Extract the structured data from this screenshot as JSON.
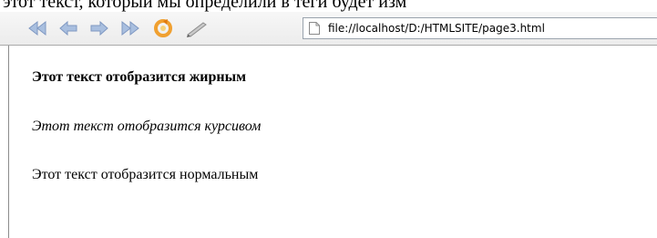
{
  "caption": "этот текст, который мы определили в теги будет изм",
  "toolbar": {
    "buttons": [
      {
        "name": "rewind-button",
        "icon": "rewind-icon"
      },
      {
        "name": "back-button",
        "icon": "back-arrow-icon"
      },
      {
        "name": "forward-button",
        "icon": "forward-arrow-icon"
      },
      {
        "name": "fast-forward-button",
        "icon": "fast-forward-icon"
      },
      {
        "name": "reload-button",
        "icon": "reload-icon"
      },
      {
        "name": "edit-button",
        "icon": "pencil-icon"
      }
    ],
    "address": {
      "url": "file://localhost/D:/HTMLSITE/page3.html",
      "icon": "page-icon"
    }
  },
  "page": {
    "bold_text": "Этот текст отобразится жирным",
    "italic_text": "Этот текст отобразится курсивом",
    "normal_text": "Этот текст отобразится нормальным"
  },
  "colors": {
    "nav_arrows": "#9fb6d8",
    "reload_orange": "#f0a030",
    "toolbar_bg": "#ececec"
  }
}
